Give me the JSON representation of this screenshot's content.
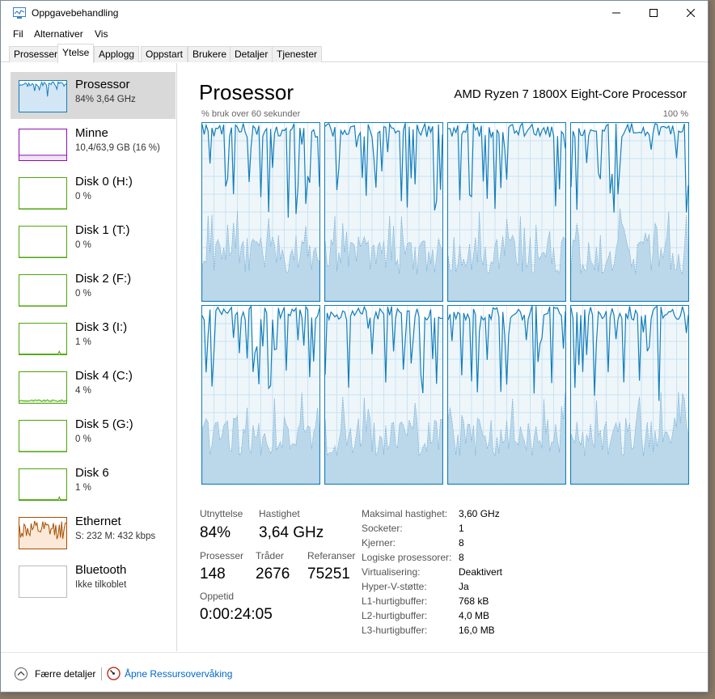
{
  "window": {
    "title": "Oppgavebehandling"
  },
  "menu": [
    "Fil",
    "Alternativer",
    "Vis"
  ],
  "tabs": [
    "Prosesser",
    "Ytelse",
    "Applogg",
    "Oppstart",
    "Brukere",
    "Detaljer",
    "Tjenester"
  ],
  "active_tab": "Ytelse",
  "sidebar": {
    "items": [
      {
        "title": "Prosessor",
        "sub": "84% 3,64 GHz",
        "color": "#117dbb",
        "fill": "#d3e6f5"
      },
      {
        "title": "Minne",
        "sub": "10,4/63,9 GB (16 %)",
        "color": "#8b12ae",
        "fill": "#f1e3f5"
      },
      {
        "title": "Disk 0 (H:)",
        "sub": "0 %",
        "color": "#4da60c",
        "fill": "#e4f2da"
      },
      {
        "title": "Disk 1 (T:)",
        "sub": "0 %",
        "color": "#4da60c",
        "fill": "#e4f2da"
      },
      {
        "title": "Disk 2 (F:)",
        "sub": "0 %",
        "color": "#4da60c",
        "fill": "#e4f2da"
      },
      {
        "title": "Disk 3 (I:)",
        "sub": "1 %",
        "color": "#4da60c",
        "fill": "#e4f2da"
      },
      {
        "title": "Disk 4 (C:)",
        "sub": "4 %",
        "color": "#4da60c",
        "fill": "#e4f2da"
      },
      {
        "title": "Disk 5 (G:)",
        "sub": "0 %",
        "color": "#4da60c",
        "fill": "#e4f2da"
      },
      {
        "title": "Disk 6",
        "sub": "1 %",
        "color": "#4da60c",
        "fill": "#e4f2da"
      },
      {
        "title": "Ethernet",
        "sub": "S: 232  M: 432 kbps",
        "color": "#a74f01",
        "fill": "#fce8d6"
      },
      {
        "title": "Bluetooth",
        "sub": "Ikke tilkoblet",
        "color": "#bbbbbb",
        "fill": "#f5f5f5"
      }
    ]
  },
  "main": {
    "title": "Prosessor",
    "model": "AMD Ryzen 7 1800X Eight-Core Processor",
    "graph_label": "% bruk over 60 sekunder",
    "graph_max": "100 %",
    "accent": "#117dbb",
    "stats": {
      "util_label": "Utnyttelse",
      "util_value": "84%",
      "speed_label": "Hastighet",
      "speed_value": "3,64 GHz",
      "proc_label": "Prosesser",
      "proc_value": "148",
      "threads_label": "Tråder",
      "threads_value": "2676",
      "handles_label": "Referanser",
      "handles_value": "75251",
      "uptime_label": "Oppetid",
      "uptime_value": "0:00:24:05"
    },
    "info": [
      {
        "key": "Maksimal hastighet:",
        "value": "3,60 GHz"
      },
      {
        "key": "Socketer:",
        "value": "1"
      },
      {
        "key": "Kjerner:",
        "value": "8"
      },
      {
        "key": "Logiske prosessorer:",
        "value": "8"
      },
      {
        "key": "Virtualisering:",
        "value": "Deaktivert"
      },
      {
        "key": "Hyper-V-støtte:",
        "value": "Ja"
      },
      {
        "key": "L1-hurtigbuffer:",
        "value": "768 kB"
      },
      {
        "key": "L2-hurtigbuffer:",
        "value": "4,0 MB"
      },
      {
        "key": "L3-hurtigbuffer:",
        "value": "16,0 MB"
      }
    ]
  },
  "footer": {
    "fewer_details": "Færre detaljer",
    "resource_monitor": "Åpne Ressursovervåking"
  }
}
